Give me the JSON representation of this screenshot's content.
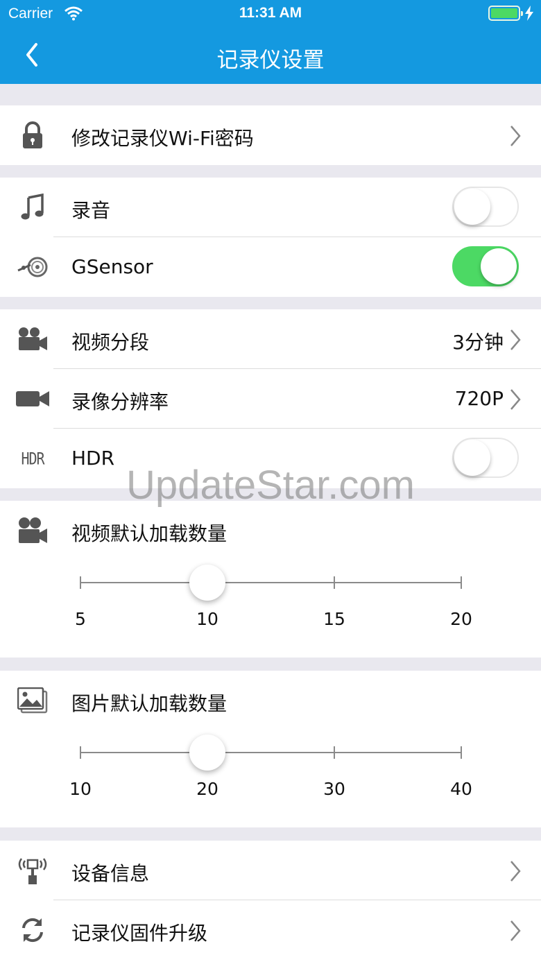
{
  "status_bar": {
    "carrier": "Carrier",
    "time": "11:31 AM"
  },
  "nav": {
    "title": "记录仪设置"
  },
  "rows": {
    "wifi_password": {
      "label": "修改记录仪Wi-Fi密码",
      "icon": "lock-icon"
    },
    "audio": {
      "label": "录音",
      "icon": "music-note-icon",
      "enabled": false
    },
    "gsensor": {
      "label": "GSensor",
      "icon": "gsensor-icon",
      "enabled": true
    },
    "segment": {
      "label": "视频分段",
      "value": "3分钟",
      "icon": "video-camera-icon"
    },
    "resolution": {
      "label": "录像分辨率",
      "value": "720P",
      "icon": "camcorder-icon"
    },
    "hdr": {
      "label": "HDR",
      "icon_text": "HDR",
      "enabled": false
    },
    "device_info": {
      "label": "设备信息",
      "icon": "antenna-icon"
    },
    "firmware": {
      "label": "记录仪固件升级",
      "icon": "refresh-icon"
    }
  },
  "video_load": {
    "label": "视频默认加载数量",
    "ticks": [
      "5",
      "10",
      "15",
      "20"
    ],
    "value": 10,
    "min": 5,
    "max": 20
  },
  "photo_load": {
    "label": "图片默认加载数量",
    "ticks": [
      "10",
      "20",
      "30",
      "40"
    ],
    "value": 20,
    "min": 10,
    "max": 40
  },
  "watermark": "UpdateStar.com",
  "colors": {
    "nav": "#1499e0",
    "toggle_on": "#4cd964",
    "background": "#e9e8ef"
  }
}
